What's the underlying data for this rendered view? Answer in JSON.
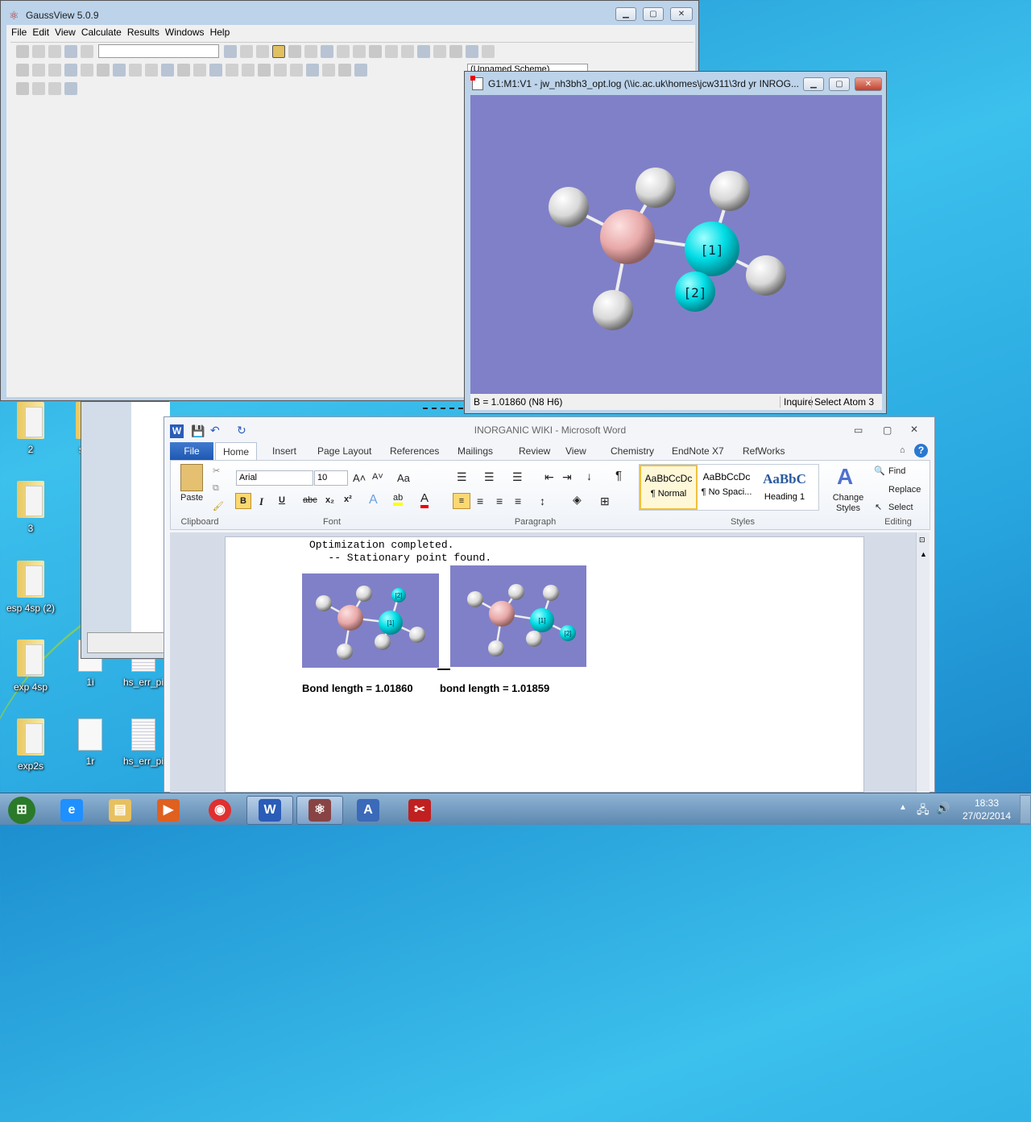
{
  "desktop": {
    "icons": [
      {
        "label": "2"
      },
      {
        "label": "styre"
      },
      {
        "label": "3"
      },
      {
        "label": "esp 4sp (2)"
      },
      {
        "label": "exp 4sp"
      },
      {
        "label": "1i"
      },
      {
        "label": "hs_err_pi"
      },
      {
        "label": "exp2s"
      },
      {
        "label": "1r"
      },
      {
        "label": "hs_err_pi"
      }
    ]
  },
  "gaussview": {
    "title": "GaussView 5.0.9",
    "menu": [
      "File",
      "Edit",
      "View",
      "Calculate",
      "Results",
      "Windows",
      "Help"
    ],
    "scheme_value": "(Unnamed Scheme)",
    "toolbar1": [
      "element-fragment-icon",
      "ring-fragment-icon",
      "r-group-icon",
      "biological-icon",
      "custom-fragment-icon",
      "fragment-combo",
      "modify-bond-icon",
      "modify-angle-icon",
      "modify-dihedral-icon",
      "inquire-icon",
      "add-valence-icon",
      "delete-atom-icon",
      "clean-icon",
      "rebuild-icon",
      "select-icon",
      "select-region-icon",
      "new-icon",
      "open-icon",
      "save-icon",
      "print-icon",
      "image-icon",
      "window-icon",
      "list-icon"
    ],
    "toolbar2": [
      "cut-icon",
      "copy-icon",
      "paste-icon",
      "delete-icon",
      "undo-icon",
      "redo-icon",
      "symmetrize-icon",
      "bond-tool-icon",
      "mirror-icon",
      "text-a-icon",
      "text-r-icon",
      "link-icon",
      "layers-icon",
      "diamond-icon",
      "atom-icon",
      "add-window-icon",
      "zoom-fit-icon",
      "view-list-icon",
      "preview-icon",
      "find-icon",
      "cube-icon",
      "scheme-icon"
    ],
    "toolbar3": [
      "cascade-icon",
      "tile-icon",
      "back-icon",
      "forward-icon"
    ]
  },
  "molwin": {
    "title": "G1:M1:V1 - jw_nh3bh3_opt.log (\\\\ic.ac.uk\\homes\\jcw311\\3rd yr INROG...",
    "labels": {
      "atom1": "[1]",
      "atom2": "[2]"
    },
    "status": {
      "measure": "B = 1.01860 (N8 H6)",
      "mode": "Inquire",
      "action": "Select Atom 3"
    },
    "colors": {
      "background": "#8080c8",
      "boron": "#f0b8b8",
      "nitrogen": "#00e0e8",
      "hydrogen": "#f0f0f0"
    }
  },
  "word": {
    "title": "INORGANIC WIKI - Microsoft Word",
    "tabs": [
      "File",
      "Home",
      "Insert",
      "Page Layout",
      "References",
      "Mailings",
      "Review",
      "View",
      "Chemistry",
      "EndNote X7",
      "RefWorks"
    ],
    "ribbon": {
      "paste": "Paste",
      "font_name": "Arial",
      "font_size": "10",
      "bold": "B",
      "italic": "I",
      "underline": "U",
      "strike": "abc",
      "sub": "x₂",
      "sup": "x²",
      "grow": "A˄",
      "shrink": "A˅",
      "case": "Aa",
      "styles": [
        {
          "preview": "AaBbCcDc",
          "name": "¶ Normal"
        },
        {
          "preview": "AaBbCcDc",
          "name": "¶ No Spaci..."
        },
        {
          "preview": "AaBbC",
          "name": "Heading 1"
        }
      ],
      "change_styles": "Change Styles",
      "find": "Find",
      "replace": "Replace",
      "select": "Select",
      "groups": [
        "Clipboard",
        "Font",
        "Paragraph",
        "Styles",
        "Editing"
      ]
    },
    "document": {
      "line1": "Optimization completed.",
      "line2": "   -- Stationary point found.",
      "caption1": "Bond length = 1.01860",
      "caption2": "bond length = 1.01859",
      "img_labels": [
        "[1]",
        "[2]"
      ]
    }
  },
  "taskbar": {
    "time": "18:33",
    "date": "27/02/2014",
    "apps": [
      "start-button",
      "internet-explorer",
      "file-explorer",
      "media-player",
      "chrome",
      "word",
      "gaussview",
      "notepad-app",
      "snipping-tool"
    ]
  }
}
